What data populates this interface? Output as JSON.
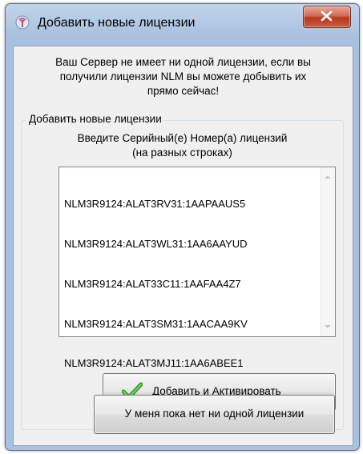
{
  "window": {
    "title": "Добавить новые лицензии"
  },
  "intro": {
    "line1": "Ваш Сервер не имеет ни одной лицензии, если вы",
    "line2": "получили лицензии NLM вы можете добывить их",
    "line3": "прямо сейчас!"
  },
  "group": {
    "legend": "Добавить новые лицензии",
    "instruction_line1": "Введите Серийный(е) Номер(а) лицензий",
    "instruction_line2": "(на разных строках)"
  },
  "licenses": [
    "NLM3R9124:ALAT3RV31:1AAPAAUS5",
    "NLM3R9124:ALAT3WL31:1AA6AAYUD",
    "NLM3R9124:ALAT33C11:1AAFAA4Z7",
    "NLM3R9124:ALAT3SM31:1AACAA9KV",
    "NLM3R9124:ALAT3MJ11:1AA6ABEE1"
  ],
  "buttons": {
    "activate_label": "Добавить и Активировать",
    "no_license_label": "У меня пока нет ни одной лицензии"
  },
  "icons": {
    "app": "antenna-icon",
    "close": "close-icon",
    "activate": "checkmark-icon"
  },
  "colors": {
    "close_button": "#c4462b",
    "checkmark": "#4aa832"
  }
}
